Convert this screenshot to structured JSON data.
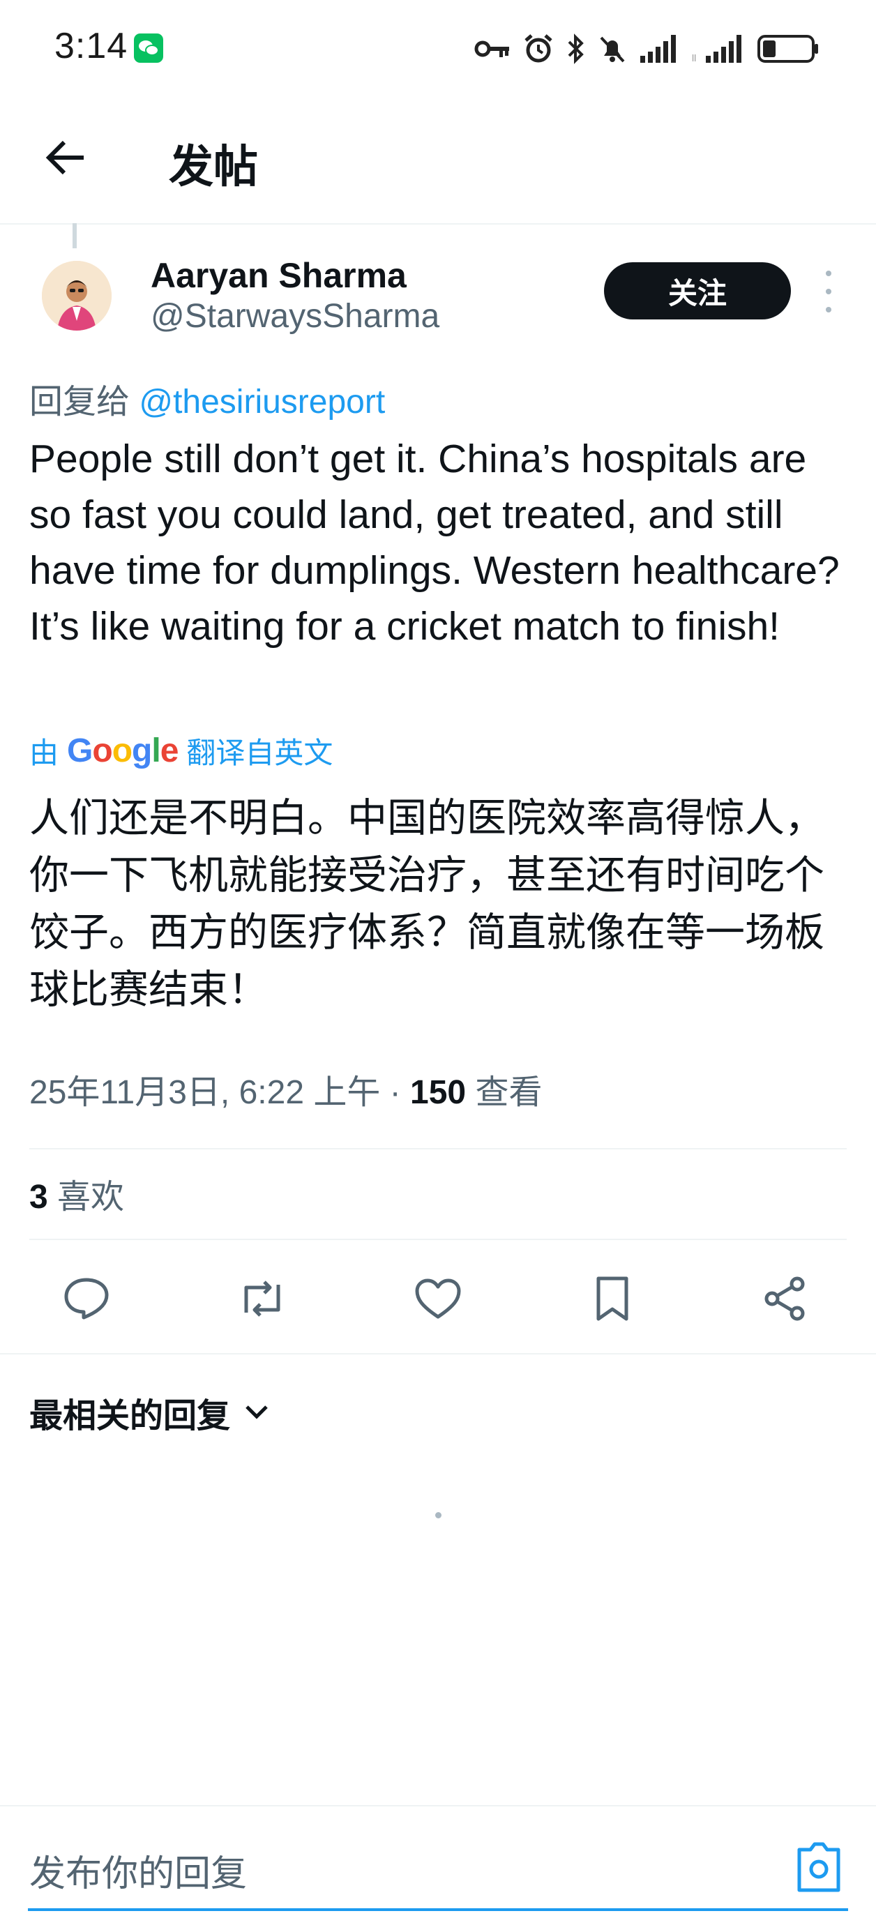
{
  "status_bar": {
    "time": "3:14"
  },
  "header": {
    "title": "发帖"
  },
  "author": {
    "name": "Aaryan Sharma",
    "handle": "@StarwaysSharma",
    "follow_label": "关注"
  },
  "post": {
    "reply_prefix": "回复给 ",
    "reply_mention": "@thesiriusreport",
    "text": "People still don’t get it. China’s hospitals are so fast you could land, get treated, and still have time for dumplings. Western healthcare? It’s like waiting for a cricket match to finish!",
    "translate_prefix": "由",
    "translate_brand": "Google",
    "translate_suffix": "翻译自英文",
    "translated_text": "人们还是不明白。中国的医院效率高得惊人，你一下飞机就能接受治疗，甚至还有时间吃个饺子。西方的医疗体系？简直就像在等一场板球比赛结束！",
    "datetime": "25年11月3日, 6:22 上午 · ",
    "views_count": "150",
    "views_label": " 查看",
    "likes_count": "3",
    "likes_label": " 喜欢"
  },
  "replies": {
    "sort_label": "最相关的回复"
  },
  "composer": {
    "placeholder": "发布你的回复"
  },
  "colors": {
    "accent": "#1d9bf0",
    "text": "#0f1419",
    "muted": "#536471",
    "divider": "#eff3f4"
  }
}
